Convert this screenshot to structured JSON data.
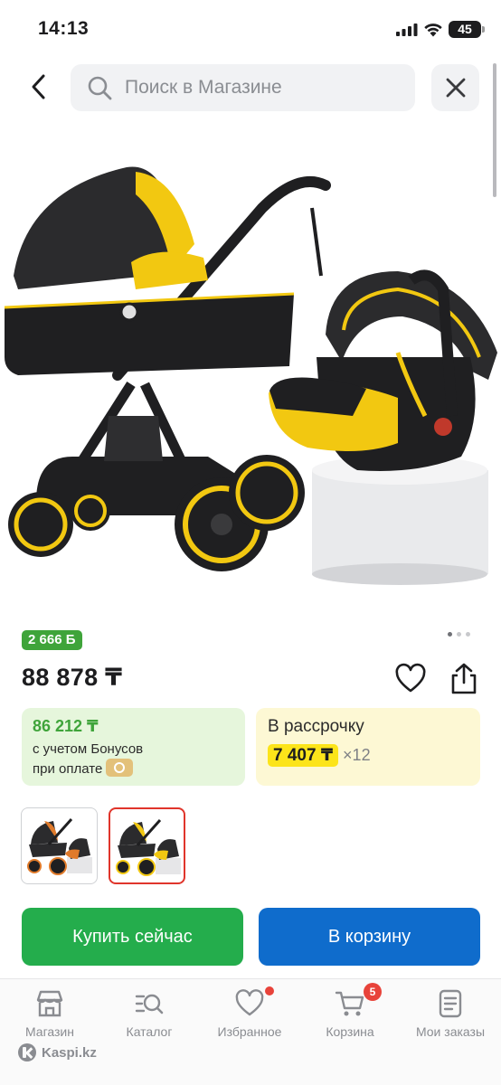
{
  "status_bar": {
    "time": "14:13",
    "battery": "45"
  },
  "search": {
    "placeholder": "Поиск в Магазине"
  },
  "product": {
    "bonus_badge": "2 666 Б",
    "price": "88 878 ₸",
    "bonus_card": {
      "amount": "86 212 ₸",
      "line1": "с учетом Бонусов",
      "line2": "при оплате"
    },
    "credit_card": {
      "title": "В рассрочку",
      "monthly": "7 407 ₸",
      "months": "×12"
    },
    "images": {
      "count": 3,
      "active_index": 0
    },
    "variants": [
      {
        "name": "orange",
        "color": "#e07a2a",
        "selected": false
      },
      {
        "name": "yellow",
        "color": "#f2c811",
        "selected": true
      }
    ]
  },
  "actions": {
    "buy_now": "Купить сейчас",
    "add_to_cart": "В корзину"
  },
  "tab_bar": {
    "items": [
      {
        "label": "Магазин",
        "icon": "store-icon"
      },
      {
        "label": "Каталог",
        "icon": "catalog-search-icon"
      },
      {
        "label": "Избранное",
        "icon": "heart-icon"
      },
      {
        "label": "Корзина",
        "icon": "cart-icon",
        "badge": "5"
      },
      {
        "label": "Мои заказы",
        "icon": "orders-icon"
      }
    ]
  },
  "brand": {
    "name": "Kaspi.kz"
  },
  "colors": {
    "bonus_green": "#3fa43a",
    "buy_green": "#24ad4c",
    "cart_blue": "#0f6ccc",
    "installment_yellow": "#fce41a",
    "badge_red": "#e8433a"
  }
}
